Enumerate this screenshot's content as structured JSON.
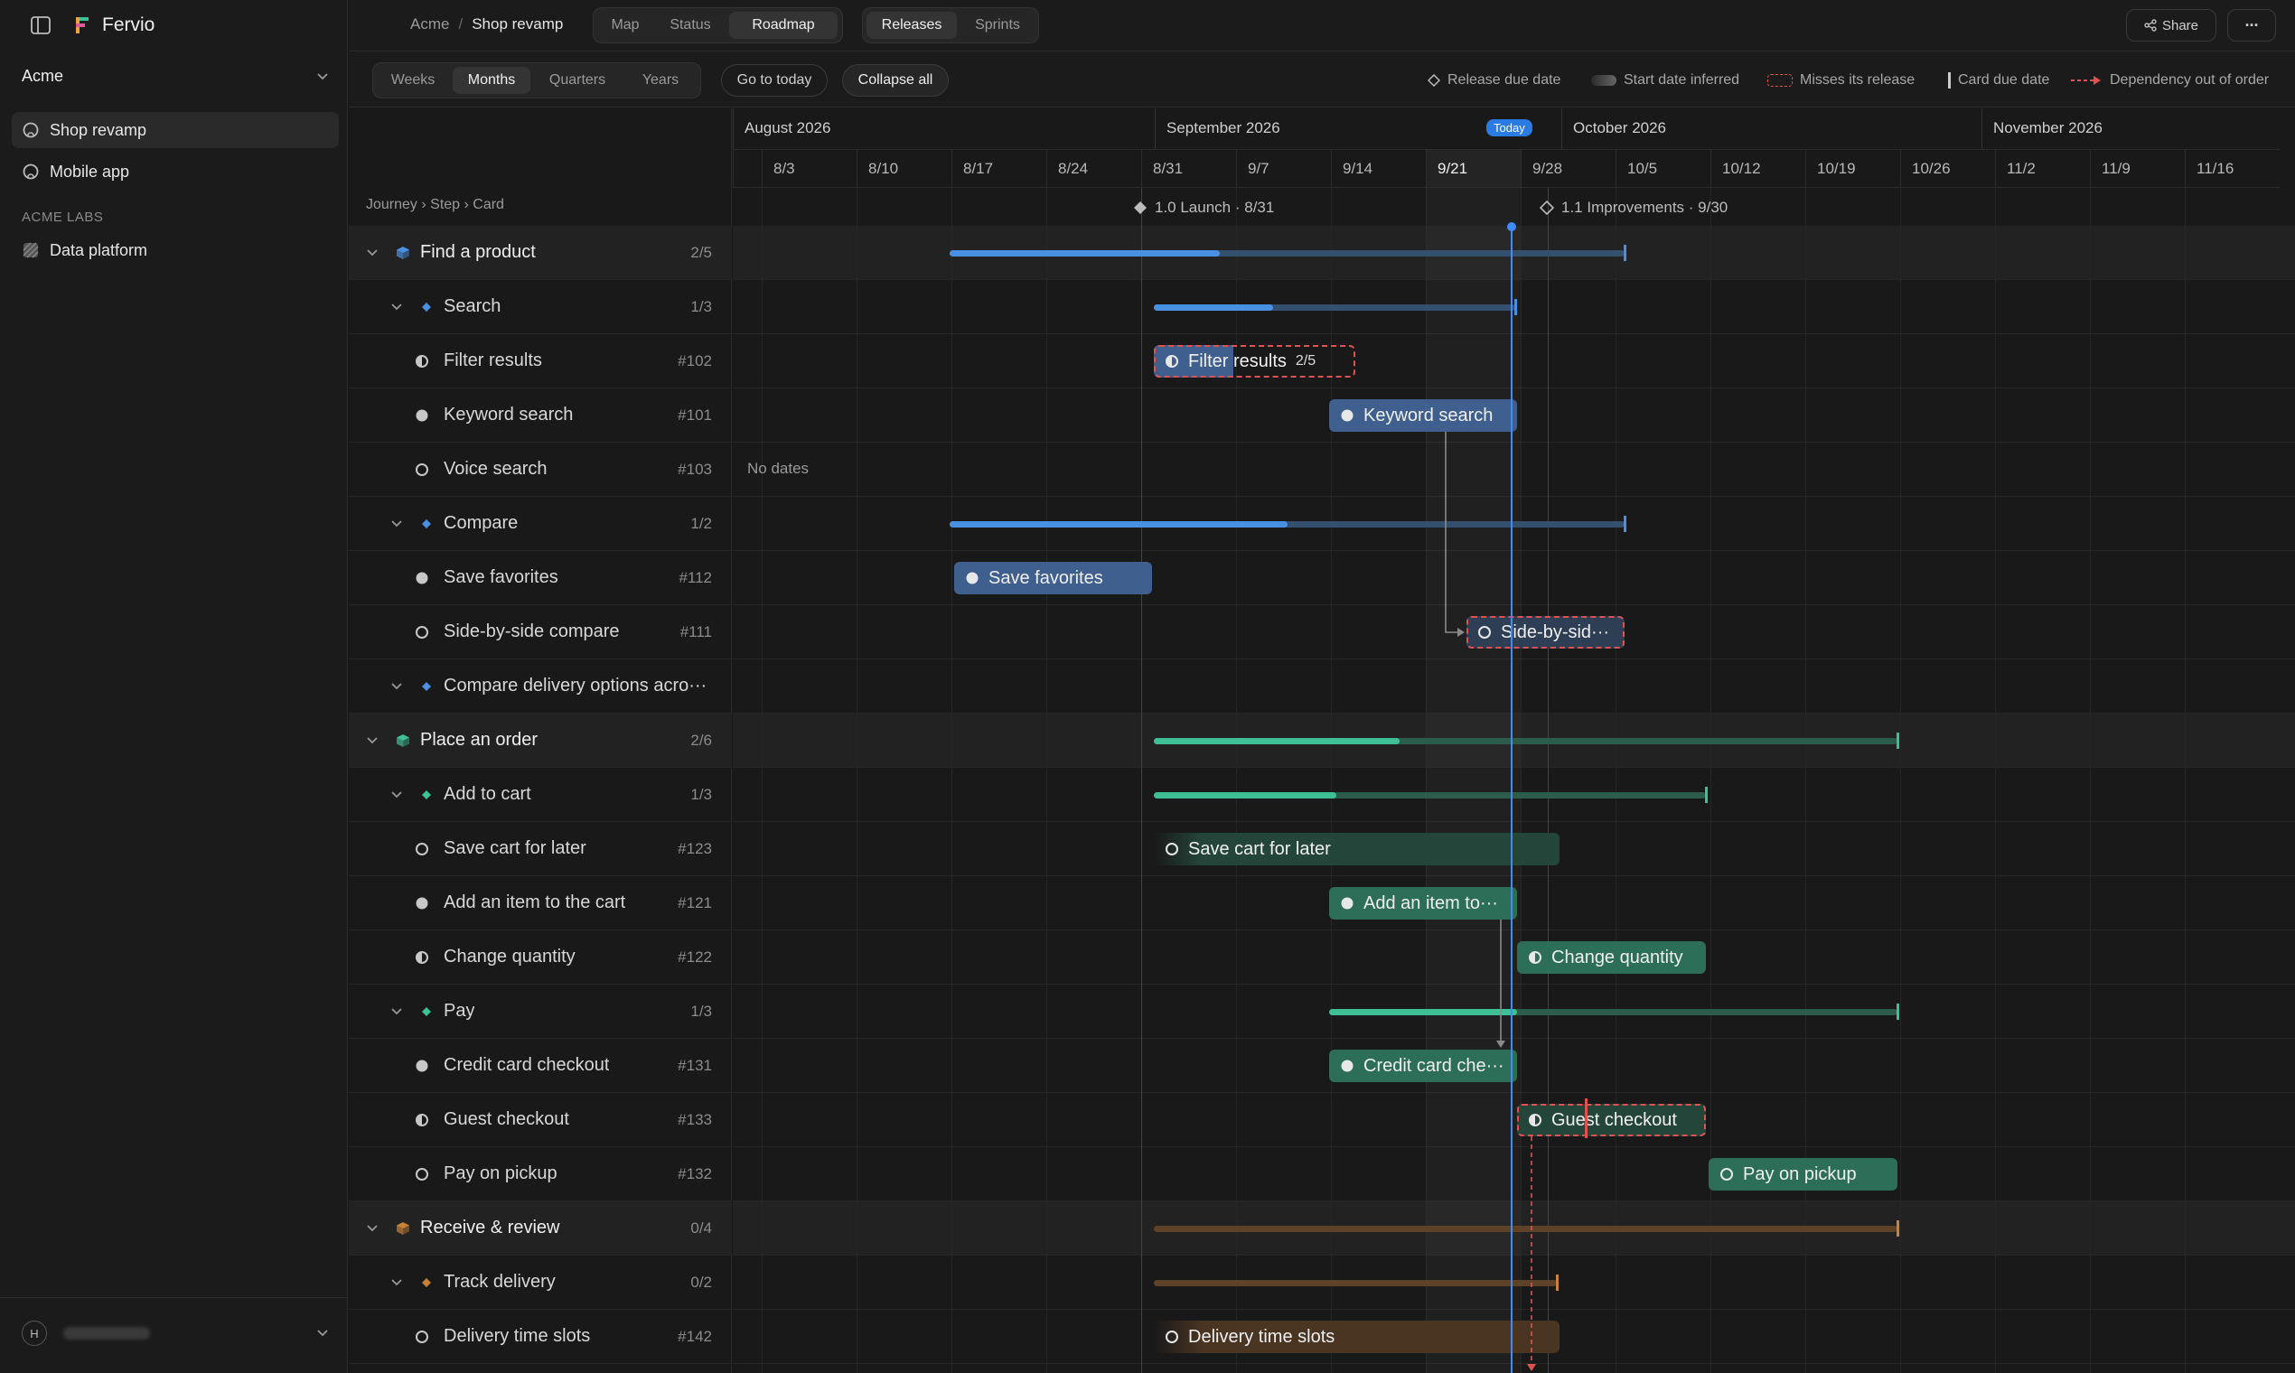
{
  "app": {
    "name": "Fervio"
  },
  "sidebar": {
    "workspace": "Acme",
    "projects": [
      {
        "label": "Shop revamp",
        "active": true
      },
      {
        "label": "Mobile app",
        "active": false
      }
    ],
    "section": "ACME LABS",
    "lab_projects": [
      {
        "label": "Data platform"
      }
    ],
    "user_initial": "H"
  },
  "breadcrumb": {
    "org": "Acme",
    "sep": "/",
    "project": "Shop revamp"
  },
  "view_tabs": [
    "Map",
    "Status",
    "Roadmap"
  ],
  "view_tab_active": "Roadmap",
  "mode_tabs": [
    "Releases",
    "Sprints"
  ],
  "mode_tab_active": "Releases",
  "header_actions": {
    "share": "Share",
    "more": "···"
  },
  "zoom_tabs": [
    "Weeks",
    "Months",
    "Quarters",
    "Years"
  ],
  "zoom_active": "Months",
  "toolbar": {
    "go_today": "Go to today",
    "collapse_all": "Collapse all"
  },
  "legend": {
    "release_due": "Release due date",
    "start_inferred": "Start date inferred",
    "misses_release": "Misses its release",
    "card_due": "Card due date",
    "dependency": "Dependency out of order"
  },
  "tree_header": "Journey › Step › Card",
  "timeline": {
    "months": [
      "August 2026",
      "September 2026",
      "October 2026",
      "November 2026"
    ],
    "today_badge": "Today",
    "weeks": [
      "8/3",
      "8/10",
      "8/17",
      "8/24",
      "8/31",
      "9/7",
      "9/14",
      "9/21",
      "9/28",
      "10/5",
      "10/12",
      "10/19",
      "10/26",
      "11/2",
      "11/9",
      "11/16"
    ],
    "current_week": "9/21",
    "releases": [
      {
        "label": "1.0 Launch · 8/31"
      },
      {
        "label": "1.1 Improvements · 9/30"
      }
    ],
    "no_dates": "No dates"
  },
  "rows": [
    {
      "kind": "journey",
      "label": "Find a product",
      "meta": "2/5",
      "progress": 0.4
    },
    {
      "kind": "step",
      "label": "Search",
      "meta": "1/3",
      "progress": 0.33
    },
    {
      "kind": "card",
      "label": "Filter results",
      "meta": "#102",
      "status": "in-progress",
      "bar_label": "Filter results",
      "bar_badge": "2/5"
    },
    {
      "kind": "card",
      "label": "Keyword search",
      "meta": "#101",
      "status": "done",
      "bar_label": "Keyword search"
    },
    {
      "kind": "card",
      "label": "Voice search",
      "meta": "#103",
      "status": "todo"
    },
    {
      "kind": "step",
      "label": "Compare",
      "meta": "1/2",
      "progress": 0.5
    },
    {
      "kind": "card",
      "label": "Save favorites",
      "meta": "#112",
      "status": "done",
      "bar_label": "Save favorites"
    },
    {
      "kind": "card",
      "label": "Side-by-side compare",
      "meta": "#111",
      "status": "todo",
      "bar_label": "Side-by-sid···"
    },
    {
      "kind": "step",
      "label": "Compare delivery options acro···",
      "meta": ""
    },
    {
      "kind": "journey",
      "label": "Place an order",
      "meta": "2/6",
      "progress": 0.33
    },
    {
      "kind": "step",
      "label": "Add to cart",
      "meta": "1/3",
      "progress": 0.33
    },
    {
      "kind": "card",
      "label": "Save cart for later",
      "meta": "#123",
      "status": "todo",
      "bar_label": "Save cart for later"
    },
    {
      "kind": "card",
      "label": "Add an item to the cart",
      "meta": "#121",
      "status": "done",
      "bar_label": "Add an item to···"
    },
    {
      "kind": "card",
      "label": "Change quantity",
      "meta": "#122",
      "status": "in-progress",
      "bar_label": "Change quantity"
    },
    {
      "kind": "step",
      "label": "Pay",
      "meta": "1/3",
      "progress": 0.33
    },
    {
      "kind": "card",
      "label": "Credit card checkout",
      "meta": "#131",
      "status": "done",
      "bar_label": "Credit card che···"
    },
    {
      "kind": "card",
      "label": "Guest checkout",
      "meta": "#133",
      "status": "in-progress",
      "bar_label": "Guest checkout"
    },
    {
      "kind": "card",
      "label": "Pay on pickup",
      "meta": "#132",
      "status": "todo",
      "bar_label": "Pay on pickup"
    },
    {
      "kind": "journey",
      "label": "Receive & review",
      "meta": "0/4",
      "progress": 0
    },
    {
      "kind": "step",
      "label": "Track delivery",
      "meta": "0/2",
      "progress": 0
    },
    {
      "kind": "card",
      "label": "Delivery time slots",
      "meta": "#142",
      "status": "todo",
      "bar_label": "Delivery time slots"
    }
  ],
  "colors": {
    "blue": "#4a90e2",
    "blue_bar": "#3f5f8f",
    "green": "#3fbf95",
    "green_bar": "#2c6e58",
    "orange": "#c98236",
    "orange_bar": "#5a3f27",
    "today_line": "#3d8bff",
    "miss": "#e05252"
  }
}
